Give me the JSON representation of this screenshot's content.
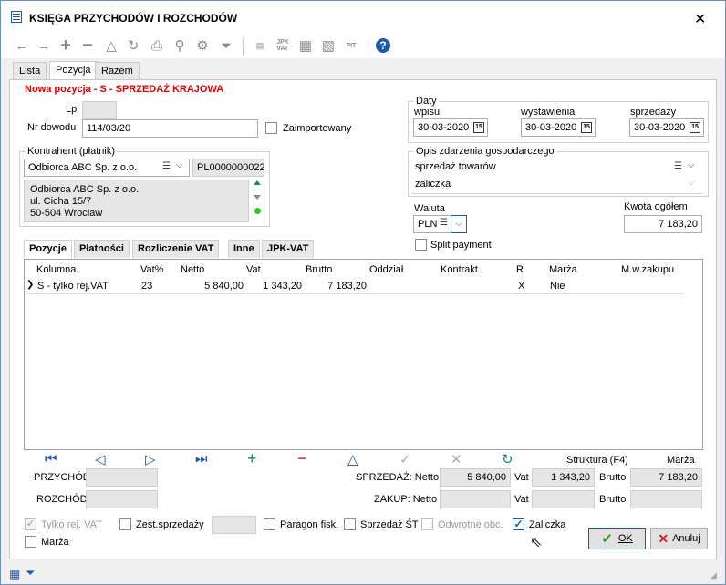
{
  "window": {
    "title": "KSIĘGA PRZYCHODÓW I ROZCHODÓW",
    "close": "✕"
  },
  "tabs": [
    "Lista",
    "Pozycja",
    "Razem"
  ],
  "heading": "Nowa pozycja - S - SPRZEDAŻ KRAJOWA",
  "form": {
    "lp_label": "Lp",
    "lp_value": "",
    "nr_label": "Nr dowodu",
    "nr_value": "114/03/20",
    "zaimport_label": "Zaimportowany",
    "kontrahent_group": "Kontrahent (płatnik)",
    "kontrahent_name": "Odbiorca ABC Sp. z o.o.",
    "kontrahent_nip": "PL0000000022",
    "address": [
      "Odbiorca ABC Sp. z o.o.",
      "ul. Cicha 15/7",
      "50-504 Wrocław"
    ],
    "daty_group": "Daty",
    "wpisu_label": "wpisu",
    "wpisu": "30-03-2020",
    "wyst_label": "wystawienia",
    "wyst": "30-03-2020",
    "sprz_label": "sprzedaży",
    "sprz": "30-03-2020",
    "opis_group": "Opis zdarzenia gospodarczego",
    "opis1": "sprzedaż towarów",
    "opis2": "zaliczka",
    "waluta_label": "Waluta",
    "waluta": "PLN",
    "kwota_label": "Kwota ogółem",
    "kwota": "7 183,20",
    "split_label": "Split payment"
  },
  "subtabs": [
    "Pozycje",
    "Płatności",
    "Rozliczenie VAT",
    "Inne",
    "JPK-VAT"
  ],
  "grid": {
    "headers": [
      "Kolumna",
      "Vat%",
      "Netto",
      "Vat",
      "Brutto",
      "Oddział",
      "Kontrakt",
      "R",
      "Marża",
      "M.w.zakupu"
    ],
    "row": [
      "S - tylko rej.VAT",
      "23",
      "5 840,00",
      "1 343,20",
      "7 183,20",
      "",
      "",
      "X",
      "Nie",
      ""
    ]
  },
  "nav": {
    "first": "⏮",
    "prev": "◁",
    "next": "▷",
    "last": "⏭",
    "add": "+",
    "remove": "−",
    "edit": "△",
    "confirm": "✓",
    "cancel": "✕",
    "refresh": "↻"
  },
  "summary": {
    "struktura": "Struktura (F4)",
    "marza": "Marża",
    "przychod": "PRZYCHÓD",
    "rozchod": "ROZCHÓD",
    "sprz_netto_label": "SPRZEDAŻ: Netto",
    "sprz_netto": "5 840,00",
    "vat_label": "Vat",
    "sprz_vat": "1 343,20",
    "brutto_label": "Brutto",
    "sprz_brutto": "7 183,20",
    "zakup_netto_label": "ZAKUP: Netto"
  },
  "bottom": {
    "tylko_vat": "Tylko rej. VAT",
    "marza": "Marża",
    "zest": "Zest.sprzedaży",
    "paragon": "Paragon fisk.",
    "sprz_st": "Sprzedaż ŚT",
    "odwrotne": "Odwrotne obc.",
    "zaliczka": "Zaliczka",
    "ok": "OK",
    "anuluj": "Anuluj"
  },
  "colors": {
    "heading": "#e00000",
    "accent": "#1e5aa8"
  }
}
